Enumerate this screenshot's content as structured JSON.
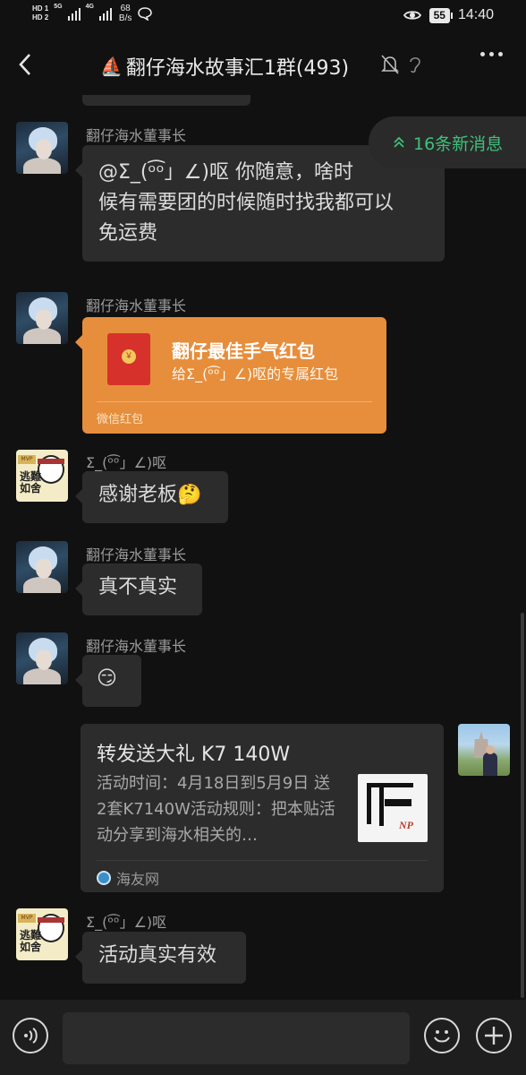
{
  "status_bar": {
    "sim1": "HD 1",
    "sim2": "HD 2",
    "net1": "5G",
    "net2": "4G",
    "speed_value": "68",
    "speed_unit": "B/s",
    "battery": "55",
    "time": "14:40"
  },
  "header": {
    "title": "翻仔海水故事汇1群(493)"
  },
  "new_messages": {
    "label": "16条新消息",
    "color": "#3fc07a"
  },
  "messages": [
    {
      "sender": "翻仔海水董事长",
      "lines": [
        "@Σ_(ᵒ͡ᵒ」∠)呕 你随意，啥时",
        "候有需要团的时候随时找我都可以",
        "免运费"
      ]
    },
    {
      "sender": "翻仔海水董事长",
      "red_packet": {
        "title": "翻仔最佳手气红包",
        "subtitle": "给Σ_(ᵒ͡ᵒ」∠)呕的专属红包",
        "footer": "微信红包",
        "color": "#e68e3c"
      }
    },
    {
      "sender": "Σ_(ᵒ͡ᵒ」∠)呕",
      "text": "感谢老板🤔"
    },
    {
      "sender": "翻仔海水董事长",
      "text": "真不真实"
    },
    {
      "sender": "翻仔海水董事长",
      "text": "😏"
    },
    {
      "link_card": {
        "title": "转发送大礼 K7 140W",
        "description": "活动时间：4月18日到5月9日 送2套K7140W活动规则：把本贴活动分享到海水相关的…",
        "source": "海友网",
        "thumb_text": "NP"
      }
    },
    {
      "sender": "Σ_(ᵒ͡ᵒ」∠)呕",
      "text": "活动真实有效"
    }
  ],
  "input": {
    "value": ""
  }
}
